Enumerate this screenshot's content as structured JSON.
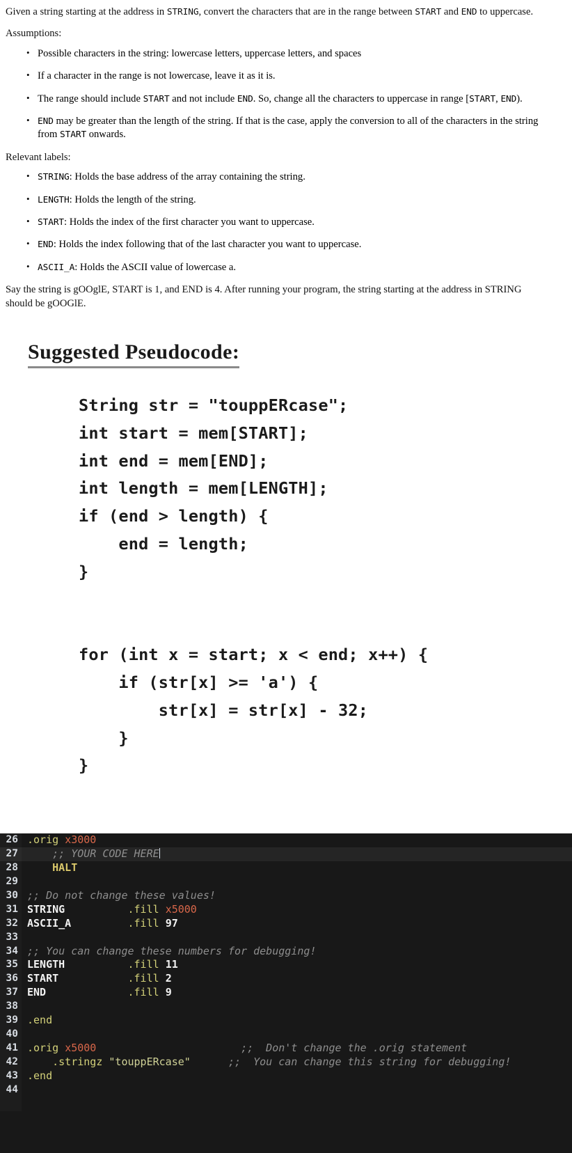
{
  "document": {
    "intro": "Given a string starting at the address in STRING, convert the characters that are in the range between START and END to uppercase.",
    "intro_parts": {
      "p1": "Given a string starting at the address in ",
      "m1": "STRING",
      "p2": ", convert the characters that are in the range between ",
      "m2": "START",
      "p3": " and ",
      "m3": "END",
      "p4": " to uppercase."
    },
    "assumptions_label": "Assumptions:",
    "assumptions": [
      {
        "parts": [
          {
            "t": "Possible characters in the string: lowercase letters, uppercase letters, and spaces",
            "mono": false
          }
        ]
      },
      {
        "parts": [
          {
            "t": "If a character in the range is not lowercase, leave it as it is.",
            "mono": false
          }
        ]
      },
      {
        "parts": [
          {
            "t": "The range should include ",
            "mono": false
          },
          {
            "t": "START",
            "mono": true
          },
          {
            "t": " and not include ",
            "mono": false
          },
          {
            "t": "END",
            "mono": true
          },
          {
            "t": ". So, change all the characters to uppercase in range [",
            "mono": false
          },
          {
            "t": "START",
            "mono": true
          },
          {
            "t": ", ",
            "mono": false
          },
          {
            "t": "END",
            "mono": true
          },
          {
            "t": ").",
            "mono": false
          }
        ]
      },
      {
        "parts": [
          {
            "t": "END",
            "mono": true
          },
          {
            "t": " may be greater than the length of the string. If that is the case, apply the conversion to all of the characters in the string from ",
            "mono": false
          },
          {
            "t": "START",
            "mono": true
          },
          {
            "t": " onwards.",
            "mono": false
          }
        ]
      }
    ],
    "labels_label": "Relevant labels:",
    "labels": [
      {
        "name": "STRING",
        "desc": ": Holds the base address of the array containing the string."
      },
      {
        "name": "LENGTH",
        "desc": ": Holds the length of the string."
      },
      {
        "name": "START",
        "desc": ": Holds the index of the first character you want to uppercase."
      },
      {
        "name": "END",
        "desc": ": Holds the index following that of the last character you want to uppercase."
      },
      {
        "name": "ASCII_A",
        "desc": ": Holds the ASCII value of lowercase a."
      }
    ],
    "example": "Say the string is gOOglE, START is 1, and END is 4. After running your program, the string starting at the address in STRING should be gOOGlE.",
    "heading": "Suggested Pseudocode:",
    "pseudocode_lines": [
      "String str = \"touppERcase\";",
      "int start = mem[START];",
      "int end = mem[END];",
      "int length = mem[LENGTH];",
      "if (end > length) {",
      "    end = length;",
      "}",
      "",
      "",
      "for (int x = start; x < end; x++) {",
      "    if (str[x] >= 'a') {",
      "        str[x] = str[x] - 32;",
      "    }",
      "}"
    ]
  },
  "editor": {
    "active_line": 27,
    "colors": {
      "background": "#181818",
      "gutter": "#1d1d1d",
      "active_line": "#252525",
      "directive": "#d3d179",
      "hex": "#d9674a",
      "opcode": "#d9c76a",
      "label": "#f2f2f2",
      "number": "#f2f2f2",
      "string": "#cfd196",
      "comment": "#8e8e8e",
      "line_number": "#d8dde3"
    },
    "lines": [
      {
        "num": "26",
        "tokens": [
          {
            "t": ".orig ",
            "c": "dir"
          },
          {
            "t": "x3000",
            "c": "hex"
          }
        ]
      },
      {
        "num": "27",
        "tokens": [
          {
            "t": "    ;; YOUR CODE HERE",
            "c": "cmt"
          }
        ],
        "caret": true
      },
      {
        "num": "28",
        "tokens": [
          {
            "t": "    HALT",
            "c": "op"
          }
        ]
      },
      {
        "num": "29",
        "tokens": []
      },
      {
        "num": "30",
        "tokens": [
          {
            "t": ";; Do not change these values!",
            "c": "cmt"
          }
        ]
      },
      {
        "num": "31",
        "tokens": [
          {
            "t": "STRING",
            "c": "label"
          },
          {
            "t": "          ",
            "c": "plain"
          },
          {
            "t": ".fill ",
            "c": "dir"
          },
          {
            "t": "x5000",
            "c": "hex"
          }
        ]
      },
      {
        "num": "32",
        "tokens": [
          {
            "t": "ASCII_A",
            "c": "label"
          },
          {
            "t": "         ",
            "c": "plain"
          },
          {
            "t": ".fill ",
            "c": "dir"
          },
          {
            "t": "97",
            "c": "num"
          }
        ]
      },
      {
        "num": "33",
        "tokens": []
      },
      {
        "num": "34",
        "tokens": [
          {
            "t": ";; You can change these numbers for debugging!",
            "c": "cmt"
          }
        ]
      },
      {
        "num": "35",
        "tokens": [
          {
            "t": "LENGTH",
            "c": "label"
          },
          {
            "t": "          ",
            "c": "plain"
          },
          {
            "t": ".fill ",
            "c": "dir"
          },
          {
            "t": "11",
            "c": "num"
          }
        ]
      },
      {
        "num": "36",
        "tokens": [
          {
            "t": "START",
            "c": "label"
          },
          {
            "t": "           ",
            "c": "plain"
          },
          {
            "t": ".fill ",
            "c": "dir"
          },
          {
            "t": "2",
            "c": "num"
          }
        ]
      },
      {
        "num": "37",
        "tokens": [
          {
            "t": "END",
            "c": "label"
          },
          {
            "t": "             ",
            "c": "plain"
          },
          {
            "t": ".fill ",
            "c": "dir"
          },
          {
            "t": "9",
            "c": "num"
          }
        ]
      },
      {
        "num": "38",
        "tokens": []
      },
      {
        "num": "39",
        "tokens": [
          {
            "t": ".end",
            "c": "dir"
          }
        ]
      },
      {
        "num": "40",
        "tokens": []
      },
      {
        "num": "41",
        "tokens": [
          {
            "t": ".orig ",
            "c": "dir"
          },
          {
            "t": "x5000",
            "c": "hex"
          },
          {
            "t": "                       ",
            "c": "plain"
          },
          {
            "t": ";;  Don't change the .orig statement",
            "c": "cmt"
          }
        ]
      },
      {
        "num": "42",
        "tokens": [
          {
            "t": "    .stringz ",
            "c": "dir"
          },
          {
            "t": "\"touppERcase\"",
            "c": "str"
          },
          {
            "t": "      ",
            "c": "plain"
          },
          {
            "t": ";;  You can change this string for debugging!",
            "c": "cmt"
          }
        ]
      },
      {
        "num": "43",
        "tokens": [
          {
            "t": ".end",
            "c": "dir"
          }
        ]
      },
      {
        "num": "44",
        "tokens": []
      },
      {
        "num": "",
        "tokens": []
      }
    ]
  }
}
